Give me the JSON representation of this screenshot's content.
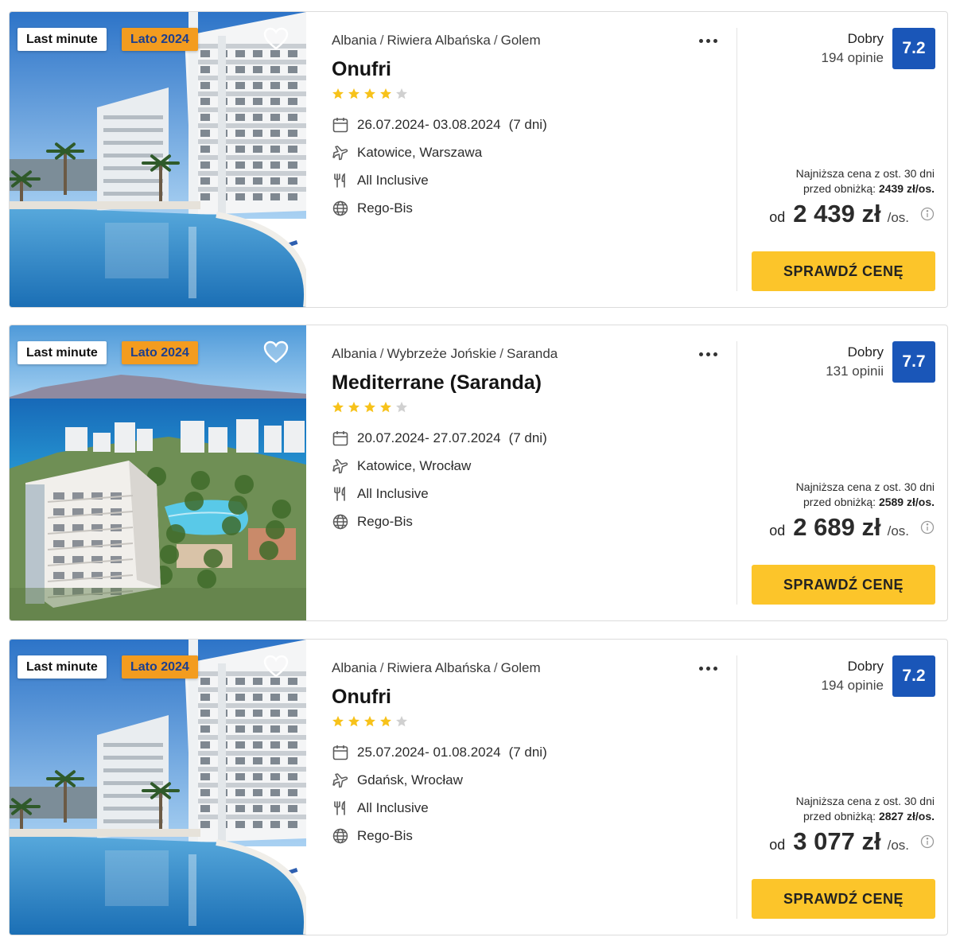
{
  "offers": [
    {
      "badges": {
        "last_minute": "Last minute",
        "season": "Lato 2024"
      },
      "photo": "hotel-onufri-pool",
      "breadcrumb": [
        "Albania",
        "Riwiera Albańska",
        "Golem"
      ],
      "name": "Onufri",
      "stars": 4,
      "dates": "26.07.2024- 03.08.2024",
      "nights": "(7 dni)",
      "departure": "Katowice, Warszawa",
      "board": "All Inclusive",
      "operator": "Rego-Bis",
      "rating_word": "Dobry",
      "reviews": "194 opinie",
      "score": "7.2",
      "lowest_line1": "Najniższa cena z ost. 30 dni",
      "lowest_prefix": "przed obniżką:",
      "lowest_value": "2439 zł/os.",
      "price_prefix": "od",
      "price": "2 439 zł",
      "price_unit": "/os.",
      "cta": "SPRAWDŹ CENĘ"
    },
    {
      "badges": {
        "last_minute": "Last minute",
        "season": "Lato 2024"
      },
      "photo": "hotel-mediterrane-sea-view",
      "breadcrumb": [
        "Albania",
        "Wybrzeże Jońskie",
        "Saranda"
      ],
      "name": "Mediterrane (Saranda)",
      "stars": 4,
      "dates": "20.07.2024- 27.07.2024",
      "nights": "(7 dni)",
      "departure": "Katowice, Wrocław",
      "board": "All Inclusive",
      "operator": "Rego-Bis",
      "rating_word": "Dobry",
      "reviews": "131 opinii",
      "score": "7.7",
      "lowest_line1": "Najniższa cena z ost. 30 dni",
      "lowest_prefix": "przed obniżką:",
      "lowest_value": "2589 zł/os.",
      "price_prefix": "od",
      "price": "2 689 zł",
      "price_unit": "/os.",
      "cta": "SPRAWDŹ CENĘ"
    },
    {
      "badges": {
        "last_minute": "Last minute",
        "season": "Lato 2024"
      },
      "photo": "hotel-onufri-pool",
      "breadcrumb": [
        "Albania",
        "Riwiera Albańska",
        "Golem"
      ],
      "name": "Onufri",
      "stars": 4,
      "dates": "25.07.2024- 01.08.2024",
      "nights": "(7 dni)",
      "departure": "Gdańsk, Wrocław",
      "board": "All Inclusive",
      "operator": "Rego-Bis",
      "rating_word": "Dobry",
      "reviews": "194 opinie",
      "score": "7.2",
      "lowest_line1": "Najniższa cena z ost. 30 dni",
      "lowest_prefix": "przed obniżką:",
      "lowest_value": "2827 zł/os.",
      "price_prefix": "od",
      "price": "3 077 zł",
      "price_unit": "/os.",
      "cta": "SPRAWDŹ CENĘ"
    }
  ],
  "colors": {
    "accent_button": "#fcc52a",
    "score_badge": "#1a56b8",
    "season_badge": "#f39c1f",
    "season_text": "#1d3f8e",
    "star_filled": "#f7c21a",
    "star_empty": "#d0d0d0"
  },
  "icons": [
    "heart-icon",
    "more-icon",
    "star-icon",
    "calendar-icon",
    "plane-icon",
    "cutlery-icon",
    "globe-icon",
    "info-icon"
  ]
}
